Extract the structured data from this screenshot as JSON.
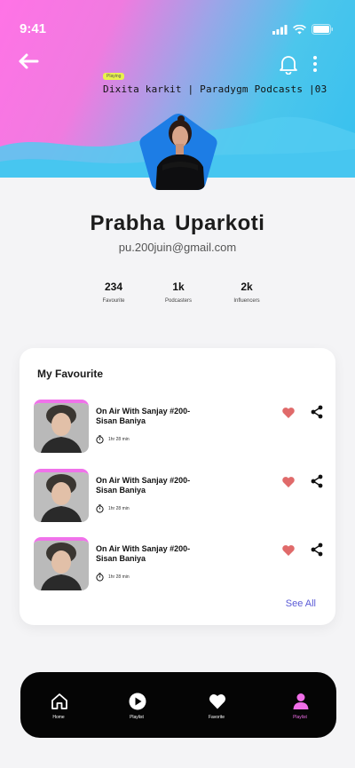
{
  "status": {
    "time": "9:41"
  },
  "header": {
    "badge": "Playing",
    "subtitle": "Dixita karkit  | Paradygm Podcasts |03"
  },
  "profile": {
    "name": "Prabha  Uparkoti",
    "email": "pu.200juin@gmail.com"
  },
  "stats": [
    {
      "value": "234",
      "label": "Favourite"
    },
    {
      "value": "1k",
      "label": "Podcasters"
    },
    {
      "value": "2k",
      "label": "Influencers"
    }
  ],
  "favourites": {
    "title": "My Favourite",
    "items": [
      {
        "title": "On Air With  Sanjay #200-Sisan Baniya",
        "duration": "1hr 28 min"
      },
      {
        "title": "On Air With  Sanjay #200-Sisan Baniya",
        "duration": "1hr 28 min"
      },
      {
        "title": "On Air With  Sanjay #200-Sisan Baniya",
        "duration": "1hr 28 min"
      }
    ],
    "see_all": "See All"
  },
  "nav": [
    {
      "label": "Home",
      "icon": "home-icon"
    },
    {
      "label": "Playlist",
      "icon": "play-circle-icon"
    },
    {
      "label": "Favorite",
      "icon": "heart-icon"
    },
    {
      "label": "Playlist",
      "icon": "user-icon",
      "active": true
    }
  ],
  "colors": {
    "accent_pink": "#f06ee8",
    "accent_blue": "#3fc3ee",
    "heart": "#e06a6a",
    "link": "#5b5bd6"
  }
}
